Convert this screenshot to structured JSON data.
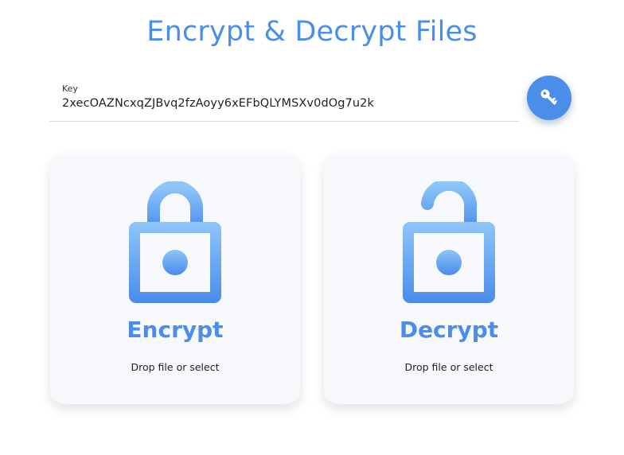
{
  "page": {
    "title": "Encrypt & Decrypt Files"
  },
  "key": {
    "label": "Key",
    "value": "2xecOAZNcxqZJBvq2fzAoyy6xEFbQLYMSXv0dOg7u2k",
    "button_icon": "key-icon"
  },
  "cards": {
    "encrypt": {
      "title": "Encrypt",
      "subtitle": "Drop file or select",
      "icon": "lock-closed-icon"
    },
    "decrypt": {
      "title": "Decrypt",
      "subtitle": "Drop file or select",
      "icon": "lock-open-icon"
    }
  },
  "colors": {
    "accent": "#4b8eea",
    "accent_light": "#8ec6f8",
    "card_bg": "#f7f8fb"
  }
}
